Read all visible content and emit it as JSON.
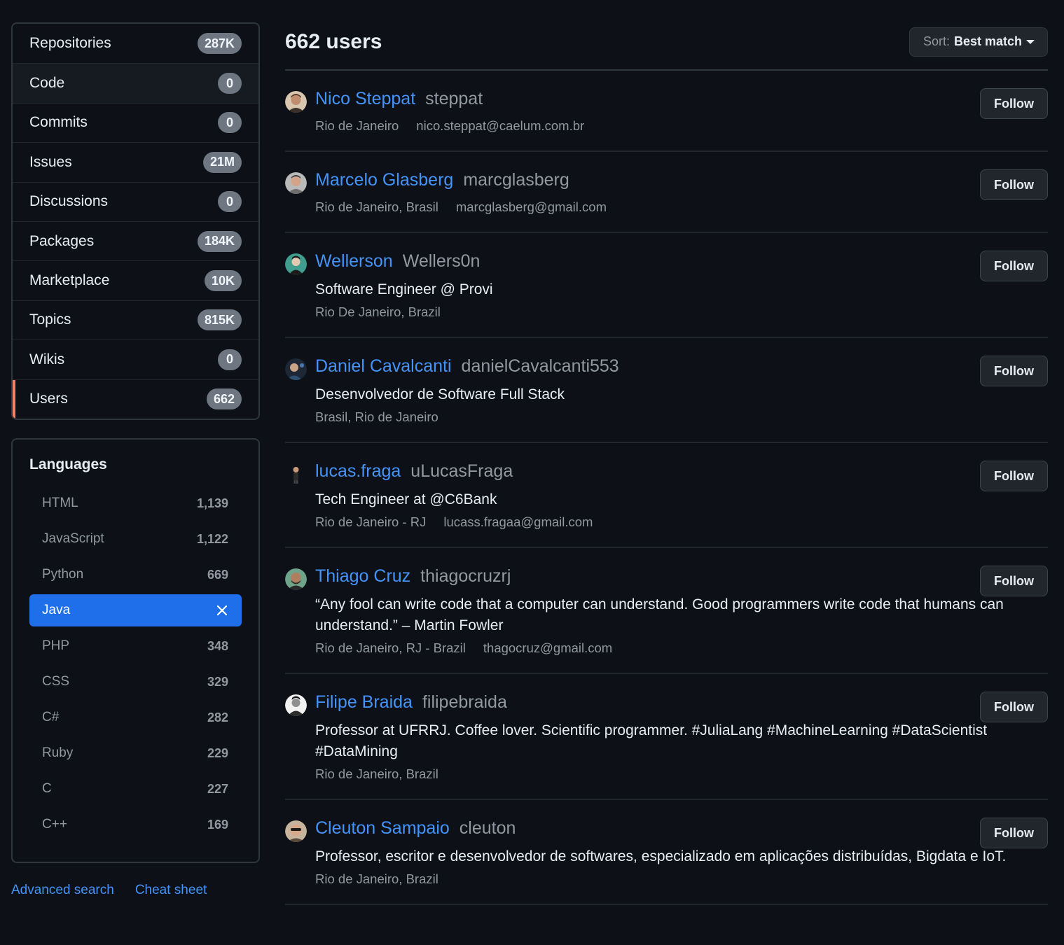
{
  "type_nav": [
    {
      "label": "Repositories",
      "count": "287K"
    },
    {
      "label": "Code",
      "count": "0"
    },
    {
      "label": "Commits",
      "count": "0"
    },
    {
      "label": "Issues",
      "count": "21M"
    },
    {
      "label": "Discussions",
      "count": "0"
    },
    {
      "label": "Packages",
      "count": "184K"
    },
    {
      "label": "Marketplace",
      "count": "10K"
    },
    {
      "label": "Topics",
      "count": "815K"
    },
    {
      "label": "Wikis",
      "count": "0"
    },
    {
      "label": "Users",
      "count": "662"
    }
  ],
  "languages": {
    "title": "Languages",
    "items": [
      {
        "label": "HTML",
        "count": "1,139"
      },
      {
        "label": "JavaScript",
        "count": "1,122"
      },
      {
        "label": "Python",
        "count": "669"
      },
      {
        "label": "Java",
        "count": ""
      },
      {
        "label": "PHP",
        "count": "348"
      },
      {
        "label": "CSS",
        "count": "329"
      },
      {
        "label": "C#",
        "count": "282"
      },
      {
        "label": "Ruby",
        "count": "229"
      },
      {
        "label": "C",
        "count": "227"
      },
      {
        "label": "C++",
        "count": "169"
      }
    ]
  },
  "footer_links": {
    "advanced_search": "Advanced search",
    "cheat_sheet": "Cheat sheet"
  },
  "results": {
    "title": "662 users",
    "sort_label": "Sort:",
    "sort_value": "Best match",
    "follow_label": "Follow"
  },
  "users": [
    {
      "name": "Nico Steppat",
      "login": "steppat",
      "bio": "",
      "location": "Rio de Janeiro",
      "email": "nico.steppat@caelum.com.br"
    },
    {
      "name": "Marcelo Glasberg",
      "login": "marcglasberg",
      "bio": "",
      "location": "Rio de Janeiro, Brasil",
      "email": "marcglasberg@gmail.com"
    },
    {
      "name": "Wellerson",
      "login": "Wellers0n",
      "bio": "Software Engineer @ Provi",
      "location": "Rio De Janeiro, Brazil",
      "email": ""
    },
    {
      "name": "Daniel Cavalcanti",
      "login": "danielCavalcanti553",
      "bio": "Desenvolvedor de Software Full Stack",
      "location": "Brasil, Rio de Janeiro",
      "email": ""
    },
    {
      "name": "lucas.fraga",
      "login": "uLucasFraga",
      "bio": "Tech Engineer at @C6Bank",
      "location": "Rio de Janeiro - RJ",
      "email": "lucass.fragaa@gmail.com"
    },
    {
      "name": "Thiago Cruz",
      "login": "thiagocruzrj",
      "bio": "“Any fool can write code that a computer can understand. Good programmers write code that humans can understand.” – Martin Fowler",
      "location": "Rio de Janeiro, RJ - Brazil",
      "email": "thagocruz@gmail.com"
    },
    {
      "name": "Filipe Braida",
      "login": "filipebraida",
      "bio": "Professor at UFRRJ. Coffee lover. Scientific programmer. #JuliaLang #MachineLearning #DataScientist #DataMining",
      "location": "Rio de Janeiro, Brazil",
      "email": ""
    },
    {
      "name": "Cleuton Sampaio",
      "login": "cleuton",
      "bio": "Professor, escritor e desenvolvedor de softwares, especializado em aplicações distribuídas, Bigdata e IoT.",
      "location": "Rio de Janeiro, Brazil",
      "email": ""
    }
  ]
}
